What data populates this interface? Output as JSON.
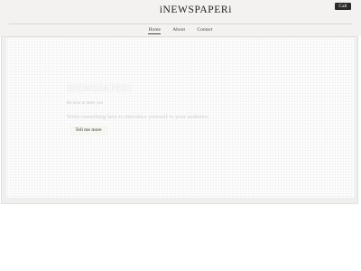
{
  "header": {
    "brand": "iNEWSPAPERi",
    "call_label": "Call"
  },
  "nav": {
    "items": [
      {
        "label": "Home",
        "active": true
      },
      {
        "label": "About",
        "active": false
      },
      {
        "label": "Contact",
        "active": false
      }
    ]
  },
  "hero": {
    "title": "iNEWSPAPERi",
    "subtitle": "Be nice to meet you",
    "description": "Write something here to introduce yourself to your audience.",
    "cta_label": "Tell me more"
  }
}
